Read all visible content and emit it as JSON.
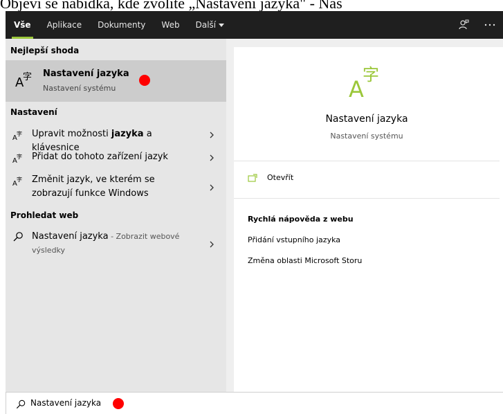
{
  "document": {
    "text": "Objeví se nabídka, kde zvolíte „Nastavení jazyka\" - Nas"
  },
  "topbar": {
    "tabs": [
      {
        "label": "Vše",
        "active": true
      },
      {
        "label": "Aplikace"
      },
      {
        "label": "Dokumenty"
      },
      {
        "label": "Web"
      },
      {
        "label": "Další"
      }
    ],
    "icons": [
      "feedback-icon",
      "more-options-icon"
    ]
  },
  "left": {
    "best_header": "Nejlepší shoda",
    "best": {
      "title": "Nastavení jazyka",
      "subtitle": "Nastavení systému",
      "icon": "language-icon"
    },
    "settings_header": "Nastavení",
    "settings": [
      {
        "pre": "Upravit možnosti ",
        "bold": "jazyka",
        "post": " a klávesnice"
      },
      {
        "pre": "Přidat do tohoto zařízení jazyk",
        "bold": "",
        "post": ""
      },
      {
        "pre": "Změnit jazyk, ve kterém se zobrazují funkce Windows",
        "bold": "",
        "post": ""
      }
    ],
    "web_header": "Prohledat web",
    "web": {
      "title": "Nastavení jazyka",
      "hint": " - Zobrazit webové výsledky"
    }
  },
  "right": {
    "title": "Nastavení jazyka",
    "subtitle": "Nastavení systému",
    "open_label": "Otevřít",
    "help_header": "Rychlá nápověda z webu",
    "help_links": [
      "Přidání vstupního jazyka",
      "Změna oblasti Microsoft Storu"
    ]
  },
  "search": {
    "value": "Nastavení jazyka"
  },
  "colors": {
    "accent": "#9bc73a",
    "topbar": "#1f1f1f",
    "left_bg": "#e6e6e6",
    "selected": "#cccccc",
    "marker": "#ff0000"
  }
}
